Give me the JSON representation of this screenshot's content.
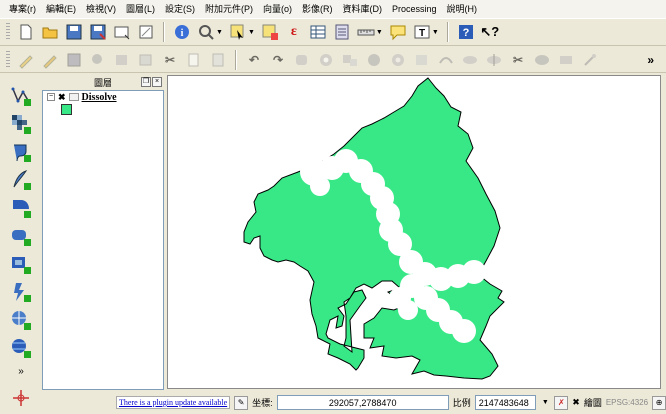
{
  "menu": [
    "專案(r)",
    "編輯(E)",
    "檢視(V)",
    "圖層(L)",
    "設定(S)",
    "附加元件(P)",
    "向量(o)",
    "影像(R)",
    "資料庫(D)",
    "Processing",
    "說明(H)"
  ],
  "layers_panel": {
    "title": "圖層",
    "layer": {
      "name": "Dissolve",
      "checked": true,
      "fill_color": "#38e887"
    }
  },
  "map": {
    "fill_color": "#38e887",
    "stroke_color": "#000000"
  },
  "status": {
    "plugin_update": "There is a plugin update available",
    "coordinate_label": "坐標:",
    "coordinate_value": "292057,2788470",
    "scale_label": "比例",
    "scale_value": "2147483648",
    "render_label": "繪圖",
    "crs": "EPSG:4326"
  },
  "icons": {
    "toolbar1": [
      "new-project-icon",
      "open-project-icon",
      "save-project-icon",
      "save-as-icon",
      "new-print-composer-icon",
      "composer-manager-icon",
      "identify-icon",
      "zoom-icon",
      "select-icon",
      "deselect-icon",
      "measure-icon",
      "attribute-table-icon",
      "field-calculator-icon",
      "measure-line-icon",
      "annotation-icon",
      "text-annotation-icon",
      "help-icon",
      "whats-this-icon"
    ],
    "toolbar2": [
      "current-edits-icon",
      "toggle-editing-icon",
      "save-edits-icon",
      "add-feature-icon",
      "move-feature-icon",
      "delete-selected-icon",
      "cut-icon",
      "copy-icon",
      "paste-icon",
      "undo-icon",
      "redo-icon",
      "simplify-icon",
      "add-ring-icon",
      "add-part-icon",
      "fill-ring-icon",
      "delete-ring-icon",
      "delete-part-icon",
      "reshape-icon",
      "offset-curve-icon",
      "split-features-icon",
      "split-parts-icon",
      "merge-features-icon",
      "merge-attributes-icon",
      "rotate-point-icon"
    ],
    "left_toolbar": [
      "add-vector-layer-icon",
      "add-raster-layer-icon",
      "add-postgis-layer-icon",
      "new-shapefile-icon",
      "add-spatialite-layer-icon",
      "add-mssql-layer-icon",
      "add-oracle-layer-icon",
      "add-wms-layer-icon",
      "add-wcs-layer-icon",
      "add-wfs-layer-icon"
    ]
  }
}
